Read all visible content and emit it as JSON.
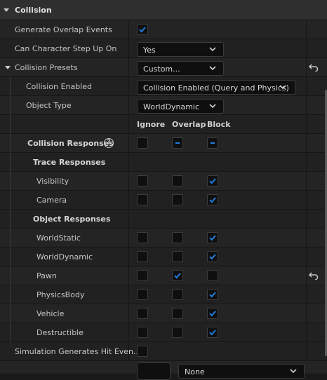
{
  "section": {
    "title": "Collision"
  },
  "properties": {
    "generate_overlap": {
      "label": "Generate Overlap Events",
      "checked": true
    },
    "step_up": {
      "label": "Can Character Step Up On",
      "value": "Yes"
    },
    "presets": {
      "label": "Collision Presets",
      "value": "Custom..."
    },
    "collision_enabled": {
      "label": "Collision Enabled",
      "value": "Collision Enabled (Query and Physics)"
    },
    "object_type": {
      "label": "Object Type",
      "value": "WorldDynamic"
    }
  },
  "columns": {
    "ignore": "Ignore",
    "overlap": "Overlap",
    "block": "Block"
  },
  "collision_responses": {
    "label": "Collision Responses",
    "help": "?"
  },
  "trace_responses": {
    "label": "Trace Responses",
    "items": [
      {
        "label": "Visibility",
        "ignore": false,
        "overlap": false,
        "block": true
      },
      {
        "label": "Camera",
        "ignore": false,
        "overlap": false,
        "block": true
      }
    ]
  },
  "object_responses": {
    "label": "Object Responses",
    "items": [
      {
        "label": "WorldStatic",
        "ignore": false,
        "overlap": false,
        "block": true
      },
      {
        "label": "WorldDynamic",
        "ignore": false,
        "overlap": false,
        "block": true
      },
      {
        "label": "Pawn",
        "ignore": false,
        "overlap": true,
        "block": false
      },
      {
        "label": "PhysicsBody",
        "ignore": false,
        "overlap": false,
        "block": true
      },
      {
        "label": "Vehicle",
        "ignore": false,
        "overlap": false,
        "block": true
      },
      {
        "label": "Destructible",
        "ignore": false,
        "overlap": false,
        "block": true
      }
    ]
  },
  "sim_hit": {
    "label": "Simulation Generates Hit Even...",
    "checked": false
  },
  "last_row": {
    "value": "None"
  },
  "icons": {
    "check": "check-icon",
    "dash": "dash-icon",
    "reset": "reset-arrow-icon",
    "chevron": "chevron-down-icon"
  },
  "colors": {
    "accent": "#1f7fe0",
    "background": "#242424",
    "header": "#2f2f2f"
  }
}
